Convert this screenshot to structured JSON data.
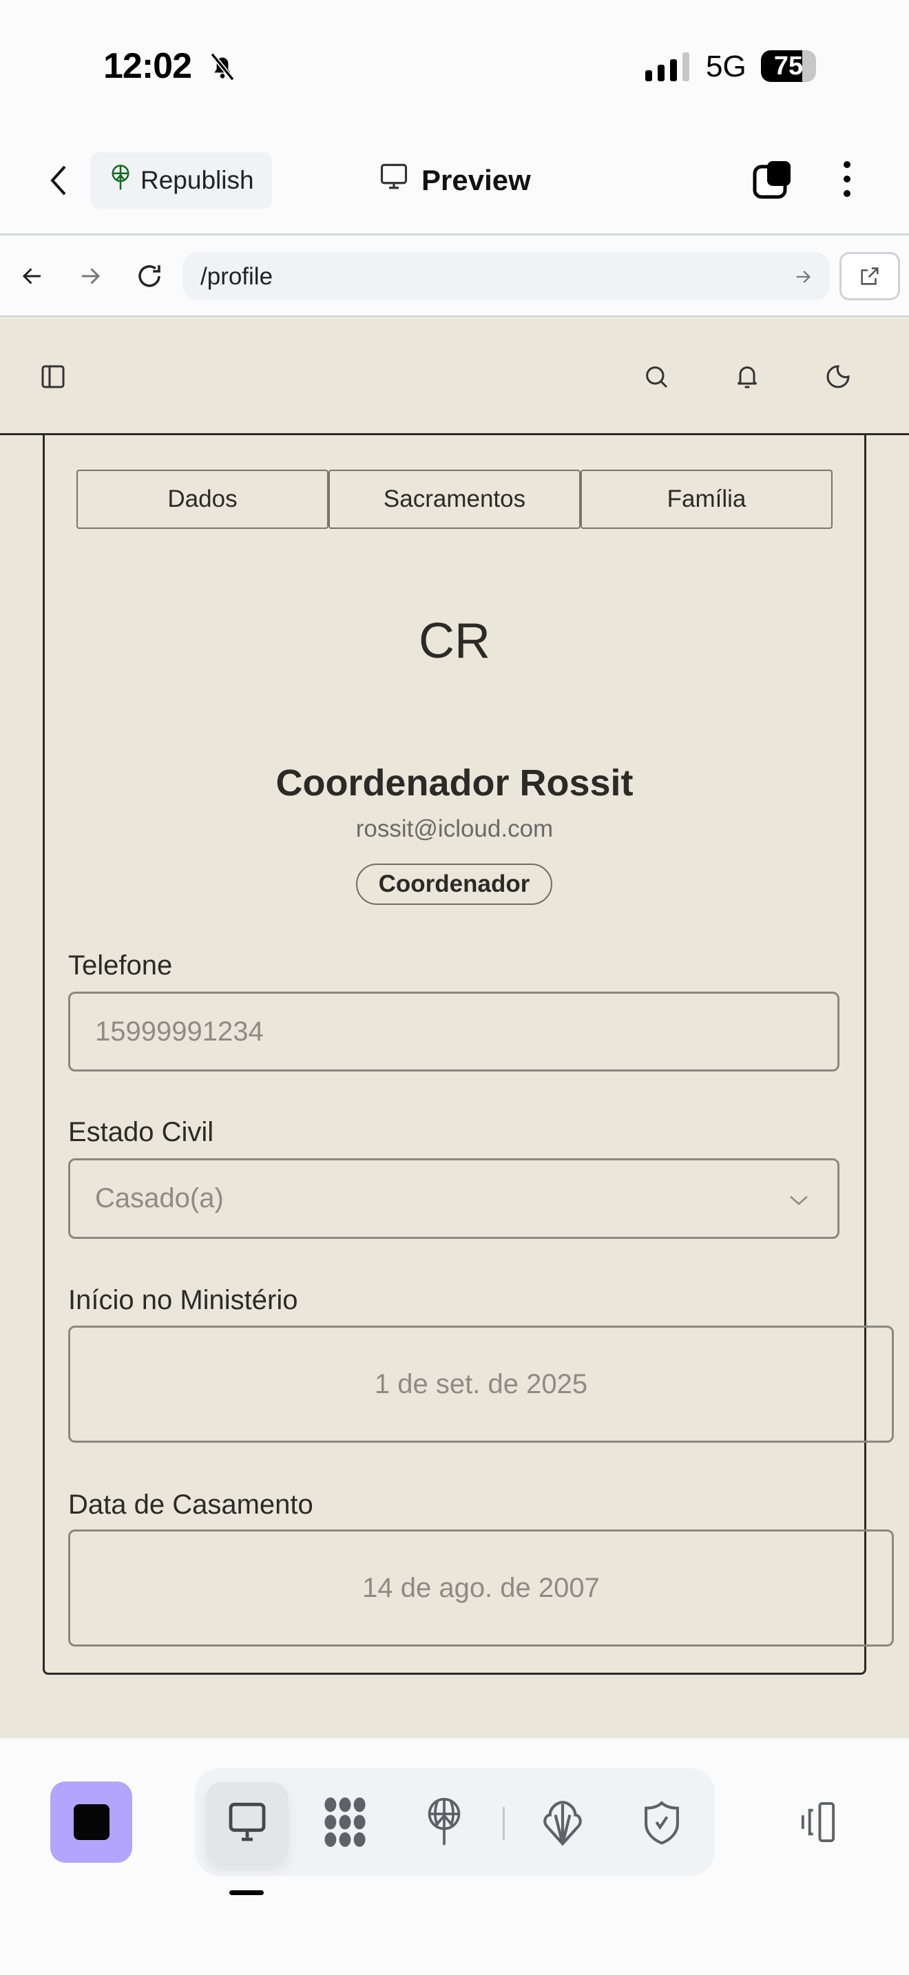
{
  "status_bar": {
    "time": "12:02",
    "network": "5G",
    "battery": "75"
  },
  "toolbar": {
    "republish_label": "Republish",
    "title": "Preview"
  },
  "browser": {
    "url": "/profile"
  },
  "profile": {
    "tabs": [
      "Dados",
      "Sacramentos",
      "Família"
    ],
    "initials": "CR",
    "name": "Coordenador Rossit",
    "email": "rossit@icloud.com",
    "role_badge": "Coordenador",
    "fields": {
      "phone_label": "Telefone",
      "phone_value": "15999991234",
      "civil_label": "Estado Civil",
      "civil_value": "Casado(a)",
      "ministry_label": "Início no Ministério",
      "ministry_value": "1 de set. de 2025",
      "wedding_label": "Data de Casamento",
      "wedding_value": "14 de ago. de 2007"
    }
  },
  "colors": {
    "app_bg": "#ebe6da",
    "accent": "#b3a4fd"
  }
}
